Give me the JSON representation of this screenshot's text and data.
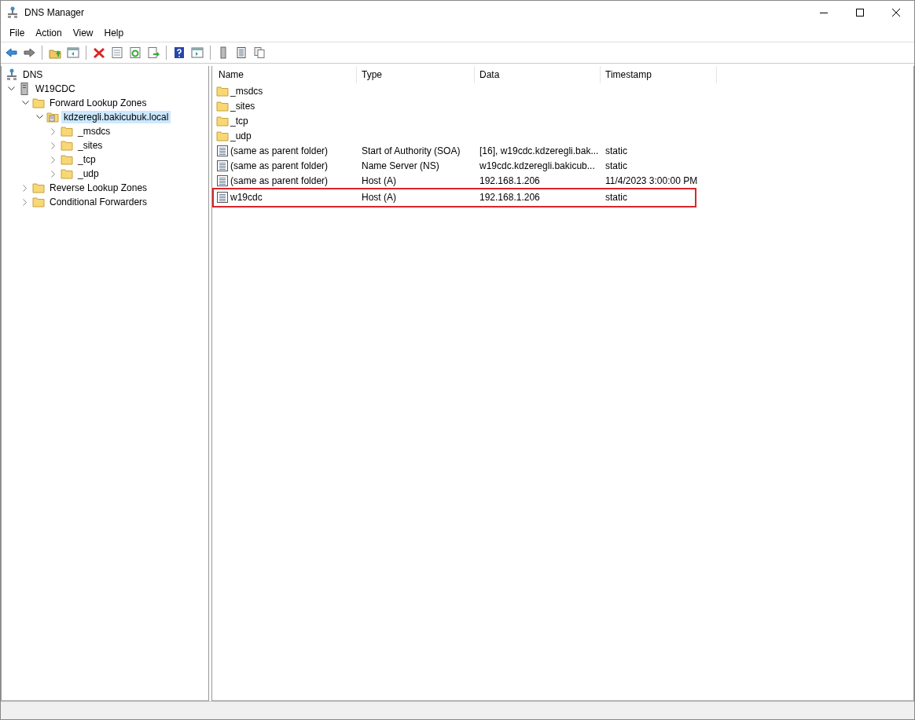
{
  "window": {
    "title": "DNS Manager"
  },
  "menu": [
    "File",
    "Action",
    "View",
    "Help"
  ],
  "tree": [
    {
      "label": "DNS",
      "kind": "dns",
      "selected": false,
      "children": [
        {
          "label": "W19CDC",
          "kind": "server",
          "expanded": true,
          "selected": false,
          "children": [
            {
              "label": "Forward Lookup Zones",
              "kind": "folder",
              "expanded": true,
              "selected": false,
              "children": [
                {
                  "label": "kdzeregli.bakicubuk.local",
                  "kind": "zone",
                  "expanded": true,
                  "selected": true,
                  "children": [
                    {
                      "label": "_msdcs",
                      "kind": "folder",
                      "expanded": false,
                      "selected": false
                    },
                    {
                      "label": "_sites",
                      "kind": "folder",
                      "expanded": false,
                      "selected": false
                    },
                    {
                      "label": "_tcp",
                      "kind": "folder",
                      "expanded": false,
                      "selected": false
                    },
                    {
                      "label": "_udp",
                      "kind": "folder",
                      "expanded": false,
                      "selected": false
                    }
                  ]
                }
              ]
            },
            {
              "label": "Reverse Lookup Zones",
              "kind": "folder",
              "expanded": false,
              "selected": false
            },
            {
              "label": "Conditional Forwarders",
              "kind": "folder",
              "expanded": false,
              "selected": false
            }
          ]
        }
      ]
    }
  ],
  "table": {
    "columns": [
      "Name",
      "Type",
      "Data",
      "Timestamp"
    ],
    "rows": [
      {
        "kind": "folder",
        "highlighted": false,
        "cells": [
          "_msdcs"
        ]
      },
      {
        "kind": "folder",
        "highlighted": false,
        "cells": [
          "_sites"
        ]
      },
      {
        "kind": "folder",
        "highlighted": false,
        "cells": [
          "_tcp"
        ]
      },
      {
        "kind": "folder",
        "highlighted": false,
        "cells": [
          "_udp"
        ]
      },
      {
        "kind": "record",
        "highlighted": false,
        "cells": [
          "(same as parent folder)",
          "Start of Authority (SOA)",
          "[16], w19cdc.kdzeregli.bak...",
          "static"
        ]
      },
      {
        "kind": "record",
        "highlighted": false,
        "cells": [
          "(same as parent folder)",
          "Name Server (NS)",
          "w19cdc.kdzeregli.bakicub...",
          "static"
        ]
      },
      {
        "kind": "record",
        "highlighted": false,
        "cells": [
          "(same as parent folder)",
          "Host (A)",
          "192.168.1.206",
          "11/4/2023 3:00:00 PM"
        ]
      },
      {
        "kind": "record",
        "highlighted": true,
        "cells": [
          "w19cdc",
          "Host (A)",
          "192.168.1.206",
          "static"
        ]
      }
    ]
  }
}
